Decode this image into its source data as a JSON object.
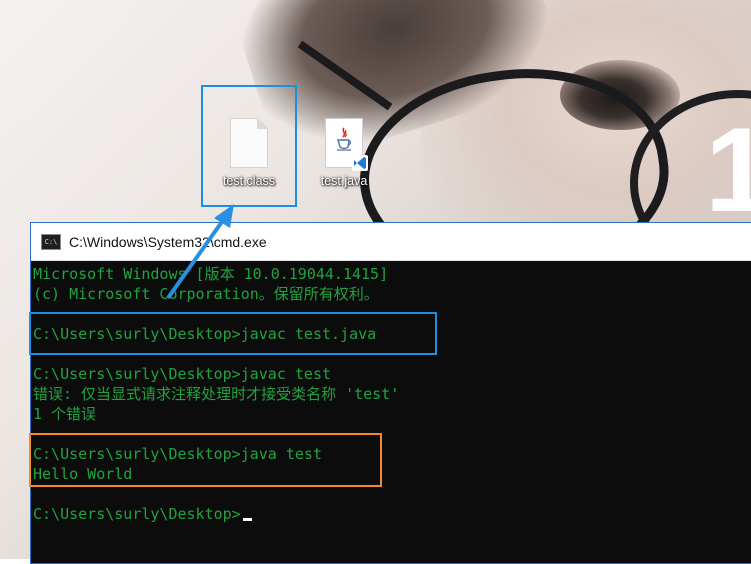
{
  "desktop": {
    "wallpaper_text": "1",
    "icons": [
      {
        "label": "test.class",
        "icon": "blank-file-icon"
      },
      {
        "label": "test.java",
        "icon": "java-file-icon"
      }
    ]
  },
  "cmd": {
    "title": "C:\\Windows\\System32\\cmd.exe",
    "lines": [
      "Microsoft Windows [版本 10.0.19044.1415]",
      "(c) Microsoft Corporation。保留所有权利。",
      "",
      "C:\\Users\\surly\\Desktop>javac test.java",
      "",
      "C:\\Users\\surly\\Desktop>javac test",
      "错误: 仅当显式请求注释处理时才接受类名称 'test'",
      "1 个错误",
      "",
      "C:\\Users\\surly\\Desktop>java test",
      "Hello World",
      "",
      "C:\\Users\\surly\\Desktop>"
    ]
  },
  "colors": {
    "console_text": "#20a33f",
    "console_bg": "#0c0c0c",
    "highlight_blue": "#1e8fe0",
    "highlight_orange": "#f08a2c"
  }
}
